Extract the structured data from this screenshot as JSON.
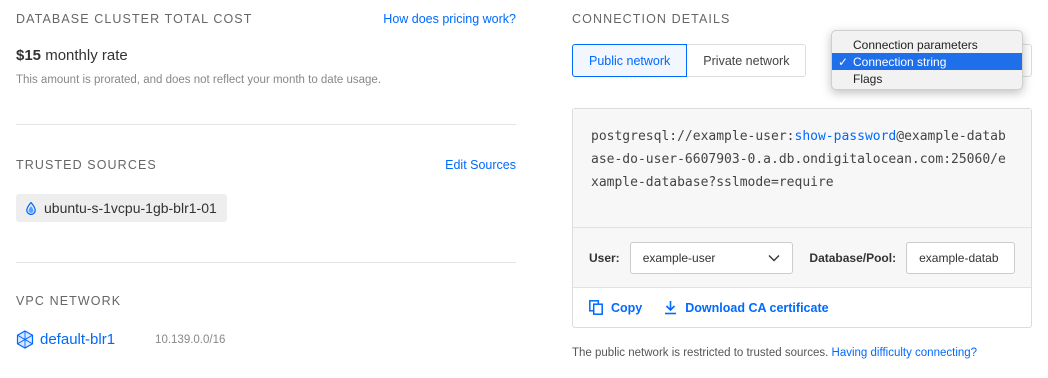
{
  "cost": {
    "title": "DATABASE CLUSTER TOTAL COST",
    "pricing_link": "How does pricing work?",
    "price_amount": "$15",
    "price_suffix": "monthly rate",
    "note": "This amount is prorated, and does not reflect your month to date usage."
  },
  "trusted_sources": {
    "title": "TRUSTED SOURCES",
    "edit_link": "Edit Sources",
    "items": [
      "ubuntu-s-1vcpu-1gb-blr1-01"
    ]
  },
  "vpc": {
    "title": "VPC NETWORK",
    "name": "default-blr1",
    "cidr": "10.139.0.0/16"
  },
  "connection": {
    "title": "CONNECTION DETAILS",
    "tabs": [
      "Public network",
      "Private network"
    ],
    "active_tab": "Public network",
    "format_options": [
      "Connection parameters",
      "Connection string",
      "Flags"
    ],
    "selected_format": "Connection string",
    "string_prefix": "postgresql://example-user:",
    "string_password": "show-password",
    "string_suffix": "@example-database-do-user-6607903-0.a.db.ondigitalocean.com:25060/example-database?sslmode=require",
    "user_label": "User:",
    "user_value": "example-user",
    "db_label": "Database/Pool:",
    "db_value": "example-datab",
    "copy_label": "Copy",
    "download_label": "Download CA certificate",
    "footnote_text": "The public network is restricted to trusted sources.",
    "footnote_link": "Having difficulty connecting?"
  },
  "colors": {
    "accent": "#0069ff",
    "menu_selected": "#1f6feb"
  }
}
